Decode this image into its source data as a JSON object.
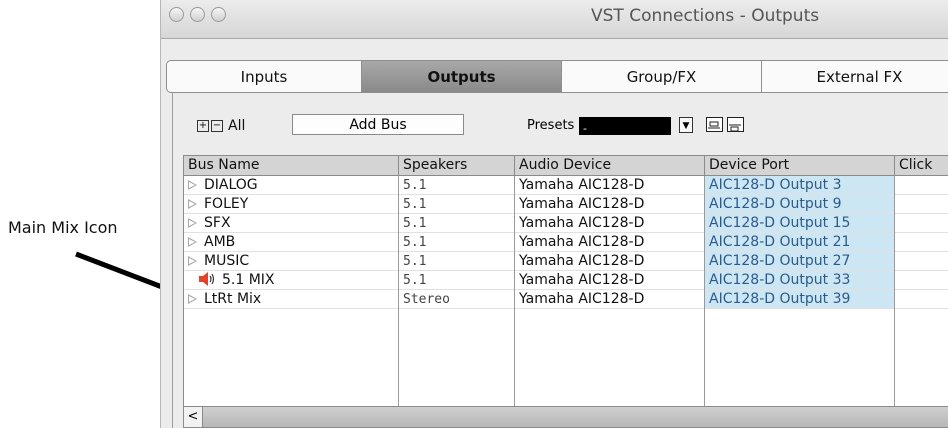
{
  "annotation": {
    "text": "Main Mix Icon"
  },
  "window": {
    "title": "VST Connections - Outputs"
  },
  "tabs": [
    {
      "label": "Inputs",
      "active": false
    },
    {
      "label": "Outputs",
      "active": true
    },
    {
      "label": "Group/FX",
      "active": false
    },
    {
      "label": "External FX",
      "active": false
    }
  ],
  "toolbar": {
    "expand_icon": "plus-box-icon",
    "collapse_icon": "minus-box-icon",
    "all_label": "All",
    "add_bus_label": "Add Bus",
    "presets_label": "Presets",
    "presets_value": "-"
  },
  "table": {
    "columns": [
      "Bus Name",
      "Speakers",
      "Audio Device",
      "Device Port",
      "Click"
    ],
    "rows": [
      {
        "name": "DIALOG",
        "speakers": "5.1",
        "device": "Yamaha AIC128-D",
        "port": "AIC128-D Output 3",
        "icon": "triangle-icon"
      },
      {
        "name": "FOLEY",
        "speakers": "5.1",
        "device": "Yamaha AIC128-D",
        "port": "AIC128-D Output 9",
        "icon": "triangle-icon"
      },
      {
        "name": "SFX",
        "speakers": "5.1",
        "device": "Yamaha AIC128-D",
        "port": "AIC128-D Output 15",
        "icon": "triangle-icon"
      },
      {
        "name": "AMB",
        "speakers": "5.1",
        "device": "Yamaha AIC128-D",
        "port": "AIC128-D Output 21",
        "icon": "triangle-icon"
      },
      {
        "name": "MUSIC",
        "speakers": "5.1",
        "device": "Yamaha AIC128-D",
        "port": "AIC128-D Output 27",
        "icon": "triangle-icon"
      },
      {
        "name": "5.1 MIX",
        "speakers": "5.1",
        "device": "Yamaha AIC128-D",
        "port": "AIC128-D Output 33",
        "icon": "speaker-icon"
      },
      {
        "name": "LtRt Mix",
        "speakers": "Stereo",
        "device": "Yamaha AIC128-D",
        "port": "AIC128-D Output 39",
        "icon": "triangle-icon"
      }
    ]
  },
  "scrollbar": {
    "left_arrow": "<"
  },
  "colors": {
    "port_bg": "#cde6f4",
    "speaker_icon": "#e0442a",
    "active_tab": "#9a9a9a"
  }
}
